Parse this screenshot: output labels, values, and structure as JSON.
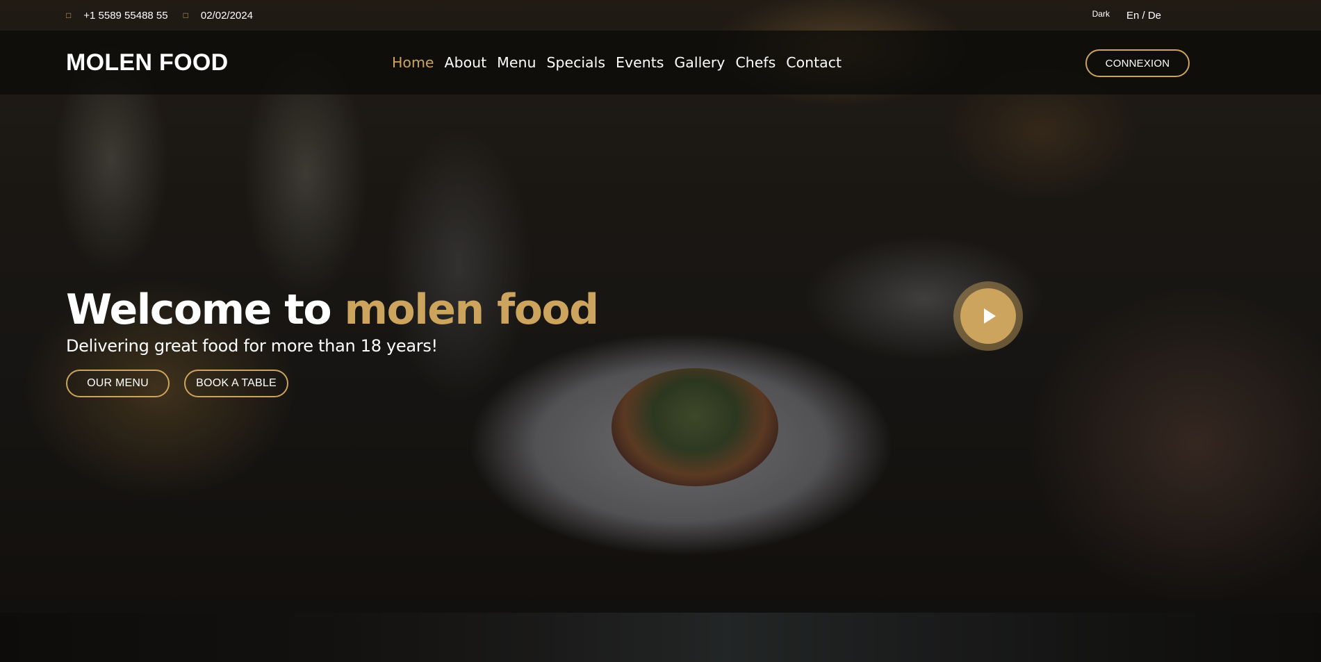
{
  "topbar": {
    "phone_icon": "phone-icon",
    "phone": "+1 5589 55488 55",
    "date_icon": "clock-icon",
    "date": "02/02/2024",
    "dark_toggle": "Dark",
    "language": "En / De"
  },
  "header": {
    "logo": "MOLEN FOOD",
    "nav": [
      {
        "label": "Home",
        "active": true
      },
      {
        "label": "About"
      },
      {
        "label": "Menu"
      },
      {
        "label": "Specials"
      },
      {
        "label": "Events"
      },
      {
        "label": "Gallery"
      },
      {
        "label": "Chefs"
      },
      {
        "label": "Contact"
      }
    ],
    "connexion_button": "CONNEXION"
  },
  "hero": {
    "title_prefix": "Welcome to ",
    "title_accent": "molen food",
    "subtitle": "Delivering great food for more than 18 years!",
    "buttons": {
      "menu": "OUR MENU",
      "book": "BOOK A TABLE"
    },
    "play_icon": "play-icon"
  },
  "colors": {
    "accent": "#cda45e",
    "background": "#0c0b09",
    "text": "#ffffff"
  }
}
